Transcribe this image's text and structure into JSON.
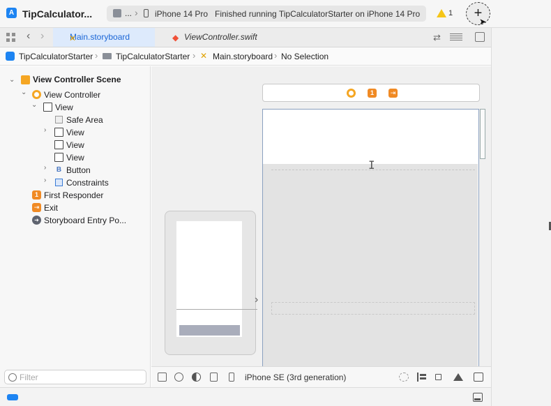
{
  "window": {
    "title": "TipCalculator...",
    "scheme_dots": "...",
    "device": "iPhone 14 Pro",
    "status": "Finished running TipCalculatorStarter on iPhone 14 Pro",
    "warning_count": "1",
    "add_button": "+"
  },
  "tabs": [
    {
      "label": "Main.storyboard",
      "active": true
    },
    {
      "label": "ViewController.swift",
      "active": false
    }
  ],
  "breadcrumb": [
    "TipCalculatorStarter",
    "TipCalculatorStarter",
    "Main.storyboard",
    "No Selection"
  ],
  "navigator": {
    "items": [
      {
        "label": "View Controller Scene",
        "icon": "scene-icon",
        "expanded": true
      },
      {
        "label": "View Controller",
        "icon": "view-controller-icon",
        "expanded": true
      },
      {
        "label": "View",
        "icon": "view-icon",
        "expanded": true
      },
      {
        "label": "Safe Area",
        "icon": "safe-area-icon"
      },
      {
        "label": "View",
        "icon": "view-icon",
        "expanded": false
      },
      {
        "label": "View",
        "icon": "view-icon"
      },
      {
        "label": "View",
        "icon": "view-icon"
      },
      {
        "label": "Button",
        "icon": "button-icon",
        "expanded": false
      },
      {
        "label": "Constraints",
        "icon": "constraints-icon",
        "expanded": false
      },
      {
        "label": "First Responder",
        "icon": "first-responder-icon"
      },
      {
        "label": "Exit",
        "icon": "exit-icon"
      },
      {
        "label": "Storyboard Entry Po...",
        "icon": "entry-point-icon"
      }
    ],
    "filter_placeholder": "Filter"
  },
  "canvas": {
    "device_label": "iPhone SE (3rd generation)",
    "dock_first_responder": "1"
  },
  "colors": {
    "accent": "#1b66d6",
    "scene_orange": "#f5a623",
    "responder_orange": "#f08a24",
    "warning_yellow": "#f5c518"
  }
}
